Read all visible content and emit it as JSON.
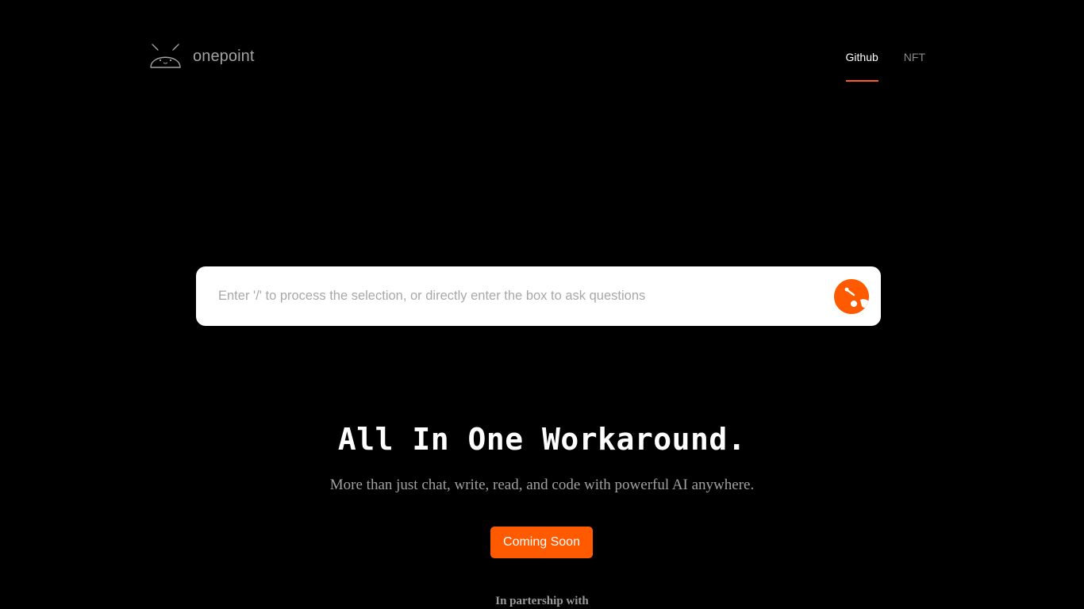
{
  "brand": {
    "name": "onepoint",
    "logo_icon": "robot-face-icon"
  },
  "nav": {
    "items": [
      {
        "label": "Github",
        "active": true
      },
      {
        "label": "NFT",
        "active": false
      }
    ]
  },
  "search": {
    "placeholder": "Enter '/' to process the selection, or directly enter the box to ask questions",
    "value": "",
    "send_icon": "onepoint-mascot-icon"
  },
  "hero": {
    "title": "All In One Workaround.",
    "subtitle": "More than just chat, write, read, and code with powerful AI anywhere.",
    "cta_label": "Coming Soon"
  },
  "partnership": {
    "label": "In partership with"
  },
  "colors": {
    "background": "#000000",
    "accent": "#ff5a00",
    "nav_underline": "#ff5a1f",
    "muted_text": "#a0a0a0"
  }
}
